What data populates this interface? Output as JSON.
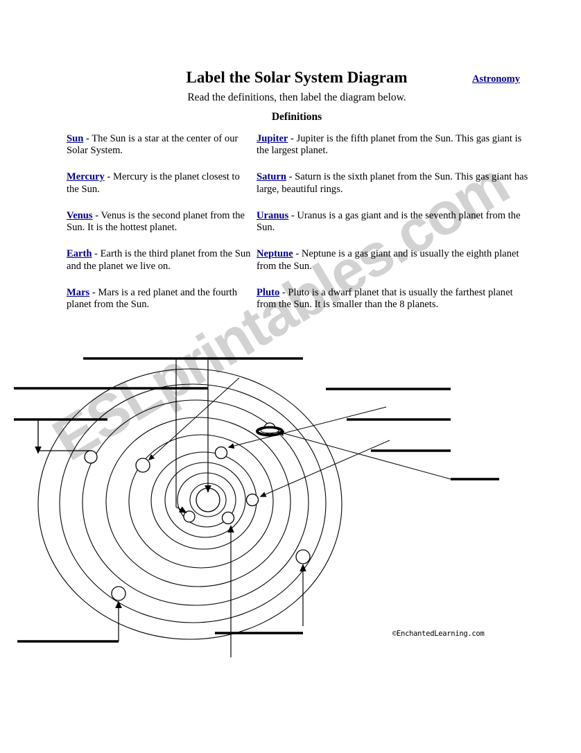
{
  "header": {
    "title": "Label the Solar System Diagram",
    "subtitle": "Read the definitions, then label the diagram below.",
    "section_heading": "Definitions",
    "category_link": "Astronomy",
    "link_color": "#00008b"
  },
  "definitions": {
    "left_column": [
      {
        "term": "Sun",
        "text": " - The Sun is a star at the center of our Solar System."
      },
      {
        "term": "Mercury",
        "text": " - Mercury is the planet closest to the Sun."
      },
      {
        "term": "Venus",
        "text": " - Venus is the second planet from the Sun. It is the hottest planet."
      },
      {
        "term": "Earth",
        "text": " - Earth is the third planet from the Sun and the planet we live on."
      },
      {
        "term": "Mars",
        "text": " - Mars is a red planet and the fourth planet from the Sun."
      }
    ],
    "right_column": [
      {
        "term": "Jupiter",
        "text": " - Jupiter is the fifth planet from the Sun. This gas giant is the largest planet."
      },
      {
        "term": "Saturn",
        "text": " - Saturn is the sixth planet from the Sun. This gas giant has large, beautiful rings."
      },
      {
        "term": "Uranus",
        "text": " - Uranus is a gas giant and is the seventh planet from the Sun."
      },
      {
        "term": "Neptune",
        "text": " - Neptune is a gas giant and is usually the eighth planet from the Sun."
      },
      {
        "term": "Pluto",
        "text": " - Pluto is a dwarf planet that is usually the farthest planet from the Sun. It is smaller than the 8 planets."
      }
    ]
  },
  "diagram": {
    "blank_label_lines_count": 10,
    "orbit_count": 9,
    "planet_markers_count": 9,
    "sun_label": "",
    "saturn_has_rings": true,
    "answer_lines_are_blank": true,
    "copyright": "©EnchantedLearning.com"
  },
  "watermark": {
    "text": "ESLprintables.com",
    "color": "#d2d2d2"
  }
}
